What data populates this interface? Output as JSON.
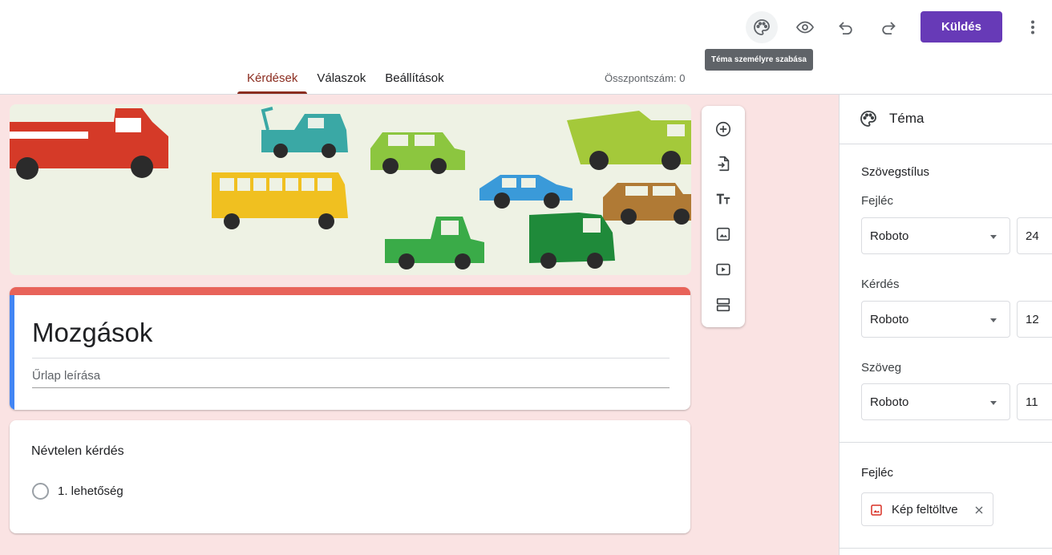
{
  "header": {
    "icons": [
      "palette-icon",
      "eye-icon",
      "undo-icon",
      "redo-icon",
      "more-vert-icon"
    ],
    "send_label": "Küldés",
    "tooltip": "Téma személyre szabása",
    "accent_color": "#673ab7"
  },
  "tabs": [
    {
      "label": "Kérdések",
      "active": true
    },
    {
      "label": "Válaszok",
      "active": false
    },
    {
      "label": "Beállítások",
      "active": false
    }
  ],
  "total_points": "Összpontszám: 0",
  "form": {
    "title": "Mozgások",
    "description_placeholder": "Űrlap leírása",
    "question": {
      "title": "Névtelen kérdés",
      "option": "1. lehetőség"
    }
  },
  "float_toolbar": {
    "icons": [
      "add-question-icon",
      "import-questions-icon",
      "add-title-icon",
      "add-image-icon",
      "add-video-icon",
      "add-section-icon"
    ]
  },
  "theme_panel": {
    "title": "Téma",
    "text_style_title": "Szövegstílus",
    "fields": [
      {
        "label": "Fejléc",
        "font": "Roboto",
        "size": "24"
      },
      {
        "label": "Kérdés",
        "font": "Roboto",
        "size": "12"
      },
      {
        "label": "Szöveg",
        "font": "Roboto",
        "size": "11"
      }
    ],
    "header_section_title": "Fejléc",
    "header_chip_label": "Kép feltöltve"
  },
  "colors": {
    "background": "#fae3e3",
    "form_accent": "#e8635a",
    "active_tab": "#8b2c1f"
  }
}
